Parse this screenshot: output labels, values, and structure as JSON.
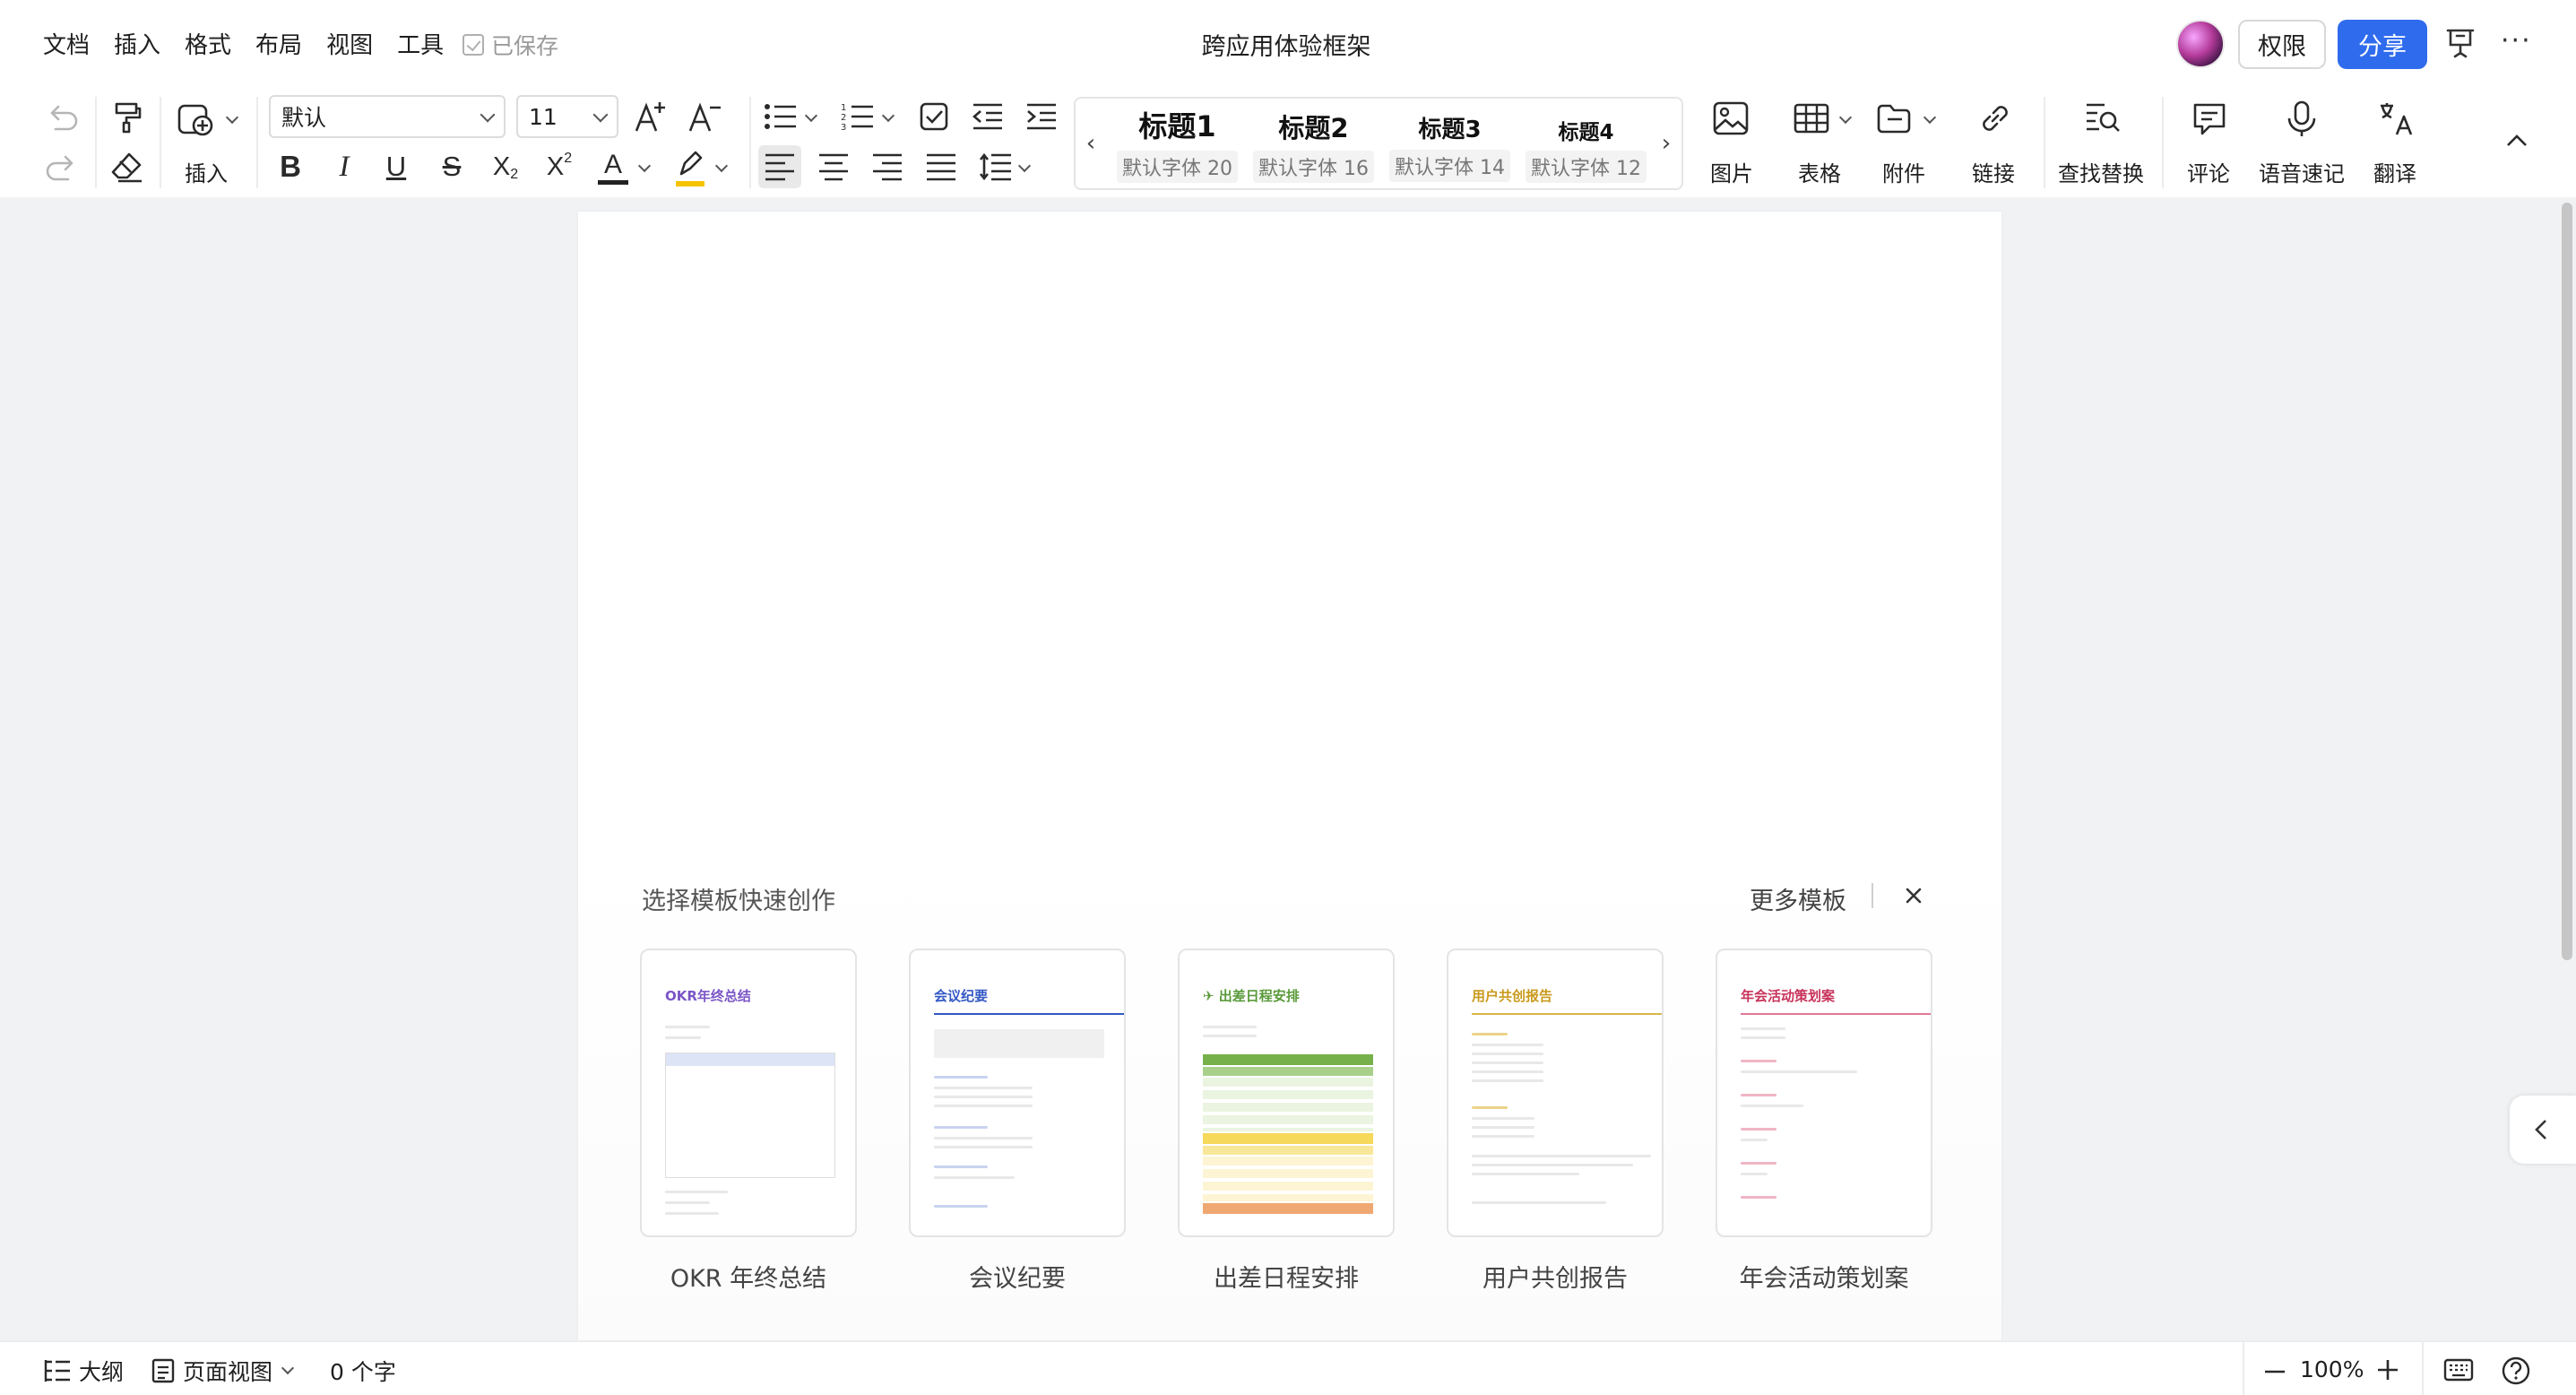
{
  "menu": [
    "文档",
    "插入",
    "格式",
    "布局",
    "视图",
    "工具"
  ],
  "save_status": "已保存",
  "doc_title": "跨应用体验框架",
  "header": {
    "permissions_label": "权限",
    "share_label": "分享"
  },
  "toolbar": {
    "insert_label": "插入",
    "font_name": "默认",
    "font_size": "11",
    "styles": [
      {
        "heading": "标题1",
        "sub": "默认字体 20"
      },
      {
        "heading": "标题2",
        "sub": "默认字体 16"
      },
      {
        "heading": "标题3",
        "sub": "默认字体 14"
      },
      {
        "heading": "标题4",
        "sub": "默认字体 12"
      }
    ],
    "image_label": "图片",
    "table_label": "表格",
    "attachment_label": "附件",
    "link_label": "链接",
    "find_replace_label": "查找替换",
    "comment_label": "评论",
    "voice_label": "语音速记",
    "translate_label": "翻译"
  },
  "templates": {
    "heading": "选择模板快速创作",
    "more_label": "更多模板",
    "items": [
      {
        "name": "OKR 年终总结",
        "preview_title": "OKR年终总结",
        "color": "#7b55c7"
      },
      {
        "name": "会议纪要",
        "preview_title": "会议纪要",
        "color": "#3358c4"
      },
      {
        "name": "出差日程安排",
        "preview_title": "✈ 出差日程安排",
        "color": "#5a9a3a"
      },
      {
        "name": "用户共创报告",
        "preview_title": "用户共创报告",
        "color": "#c99a1c"
      },
      {
        "name": "年会活动策划案",
        "preview_title": "年会活动策划案",
        "color": "#c8325a"
      }
    ]
  },
  "status": {
    "outline_label": "大纲",
    "view_label": "页面视图",
    "word_count": "0 个字",
    "zoom": "100%"
  }
}
